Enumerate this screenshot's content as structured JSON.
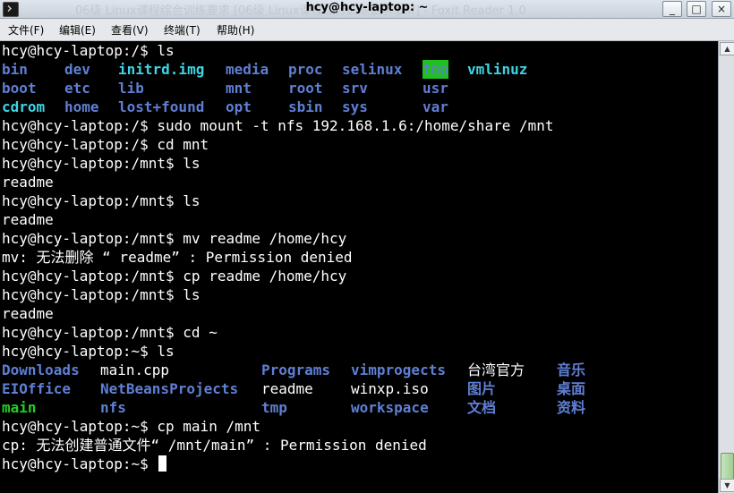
{
  "window": {
    "background_title": "06级 Linux课程综合训练要求 [06级 Linux课程综合训练要求.pdf] - Foxit Reader 1.0",
    "title": "hcy@hcy-laptop: ~",
    "buttons": {
      "minimize": "_",
      "maximize": "□",
      "close": "×"
    }
  },
  "menu": {
    "items": [
      "文件(F)",
      "编辑(E)",
      "查看(V)",
      "终端(T)",
      "帮助(H)"
    ]
  },
  "colors": {
    "directory": "#5f7fd3",
    "executable": "#20d020",
    "symlink": "#3ed4e4",
    "text": "#ffffff",
    "background": "#000000"
  },
  "terminal": {
    "lines": [
      {
        "segments": [
          {
            "text": "hcy@hcy-laptop:/$ ls",
            "style": "plain"
          }
        ]
      },
      {
        "segments": [
          {
            "text": "bin",
            "style": "dir",
            "col": 0
          },
          {
            "text": "dev",
            "style": "dir",
            "col": 70
          },
          {
            "text": "initrd.img",
            "style": "lnk",
            "col": 130
          },
          {
            "text": "media",
            "style": "dir",
            "col": 250
          },
          {
            "text": "proc",
            "style": "dir",
            "col": 320
          },
          {
            "text": "selinux",
            "style": "dir",
            "col": 380
          },
          {
            "text": "tmp",
            "style": "sticky",
            "col": 470
          },
          {
            "text": "vmlinuz",
            "style": "lnk",
            "col": 520
          }
        ]
      },
      {
        "segments": [
          {
            "text": "boot",
            "style": "dir",
            "col": 0
          },
          {
            "text": "etc",
            "style": "dir",
            "col": 70
          },
          {
            "text": "lib",
            "style": "dir",
            "col": 130
          },
          {
            "text": "mnt",
            "style": "dir",
            "col": 250
          },
          {
            "text": "root",
            "style": "dir",
            "col": 320
          },
          {
            "text": "srv",
            "style": "dir",
            "col": 380
          },
          {
            "text": "usr",
            "style": "dir",
            "col": 470
          }
        ]
      },
      {
        "segments": [
          {
            "text": "cdrom",
            "style": "lnk",
            "col": 0
          },
          {
            "text": "home",
            "style": "dir",
            "col": 70
          },
          {
            "text": "lost+found",
            "style": "dir",
            "col": 130
          },
          {
            "text": "opt",
            "style": "dir",
            "col": 250
          },
          {
            "text": "sbin",
            "style": "dir",
            "col": 320
          },
          {
            "text": "sys",
            "style": "dir",
            "col": 380
          },
          {
            "text": "var",
            "style": "dir",
            "col": 470
          }
        ]
      },
      {
        "segments": [
          {
            "text": "hcy@hcy-laptop:/$ sudo mount -t nfs 192.168.1.6:/home/share /mnt",
            "style": "plain"
          }
        ]
      },
      {
        "segments": [
          {
            "text": "hcy@hcy-laptop:/$ cd mnt",
            "style": "plain"
          }
        ]
      },
      {
        "segments": [
          {
            "text": "hcy@hcy-laptop:/mnt$ ls",
            "style": "plain"
          }
        ]
      },
      {
        "segments": [
          {
            "text": "readme",
            "style": "plain"
          }
        ]
      },
      {
        "segments": [
          {
            "text": "hcy@hcy-laptop:/mnt$ ls",
            "style": "plain"
          }
        ]
      },
      {
        "segments": [
          {
            "text": "readme",
            "style": "plain"
          }
        ]
      },
      {
        "segments": [
          {
            "text": "hcy@hcy-laptop:/mnt$ mv readme /home/hcy",
            "style": "plain"
          }
        ]
      },
      {
        "segments": [
          {
            "text": "mv: 无法删除 “ readme” : Permission denied",
            "style": "plain"
          }
        ]
      },
      {
        "segments": [
          {
            "text": "hcy@hcy-laptop:/mnt$ cp readme /home/hcy",
            "style": "plain"
          }
        ]
      },
      {
        "segments": [
          {
            "text": "hcy@hcy-laptop:/mnt$ ls",
            "style": "plain"
          }
        ]
      },
      {
        "segments": [
          {
            "text": "readme",
            "style": "plain"
          }
        ]
      },
      {
        "segments": [
          {
            "text": "hcy@hcy-laptop:/mnt$ cd ~",
            "style": "plain"
          }
        ]
      },
      {
        "segments": [
          {
            "text": "hcy@hcy-laptop:~$ ls",
            "style": "plain"
          }
        ]
      },
      {
        "segments": [
          {
            "text": "Downloads",
            "style": "dir",
            "col": 0
          },
          {
            "text": "main.cpp",
            "style": "plain",
            "col": 110
          },
          {
            "text": "Programs",
            "style": "dir",
            "col": 290
          },
          {
            "text": "vimprogects",
            "style": "dir",
            "col": 390
          },
          {
            "text": "台湾官方",
            "style": "plain",
            "col": 520
          },
          {
            "text": "音乐",
            "style": "dir",
            "col": 620
          }
        ]
      },
      {
        "segments": [
          {
            "text": "EIOffice",
            "style": "dir",
            "col": 0
          },
          {
            "text": "NetBeansProjects",
            "style": "dir",
            "col": 110
          },
          {
            "text": "readme",
            "style": "plain",
            "col": 290
          },
          {
            "text": "winxp.iso",
            "style": "plain",
            "col": 390
          },
          {
            "text": "图片",
            "style": "dir",
            "col": 520
          },
          {
            "text": "桌面",
            "style": "dir",
            "col": 620
          }
        ]
      },
      {
        "segments": [
          {
            "text": "main",
            "style": "exe",
            "col": 0
          },
          {
            "text": "nfs",
            "style": "dir",
            "col": 110
          },
          {
            "text": "tmp",
            "style": "dir",
            "col": 290
          },
          {
            "text": "workspace",
            "style": "dir",
            "col": 390
          },
          {
            "text": "文档",
            "style": "dir",
            "col": 520
          },
          {
            "text": "资料",
            "style": "dir",
            "col": 620
          }
        ]
      },
      {
        "segments": [
          {
            "text": "hcy@hcy-laptop:~$ cp main /mnt",
            "style": "plain"
          }
        ]
      },
      {
        "segments": [
          {
            "text": "cp: 无法创建普通文件“ /mnt/main” : Permission denied",
            "style": "plain"
          }
        ]
      },
      {
        "segments": [
          {
            "text": "hcy@hcy-laptop:~$ ",
            "style": "plain"
          }
        ],
        "cursor": true
      }
    ]
  }
}
